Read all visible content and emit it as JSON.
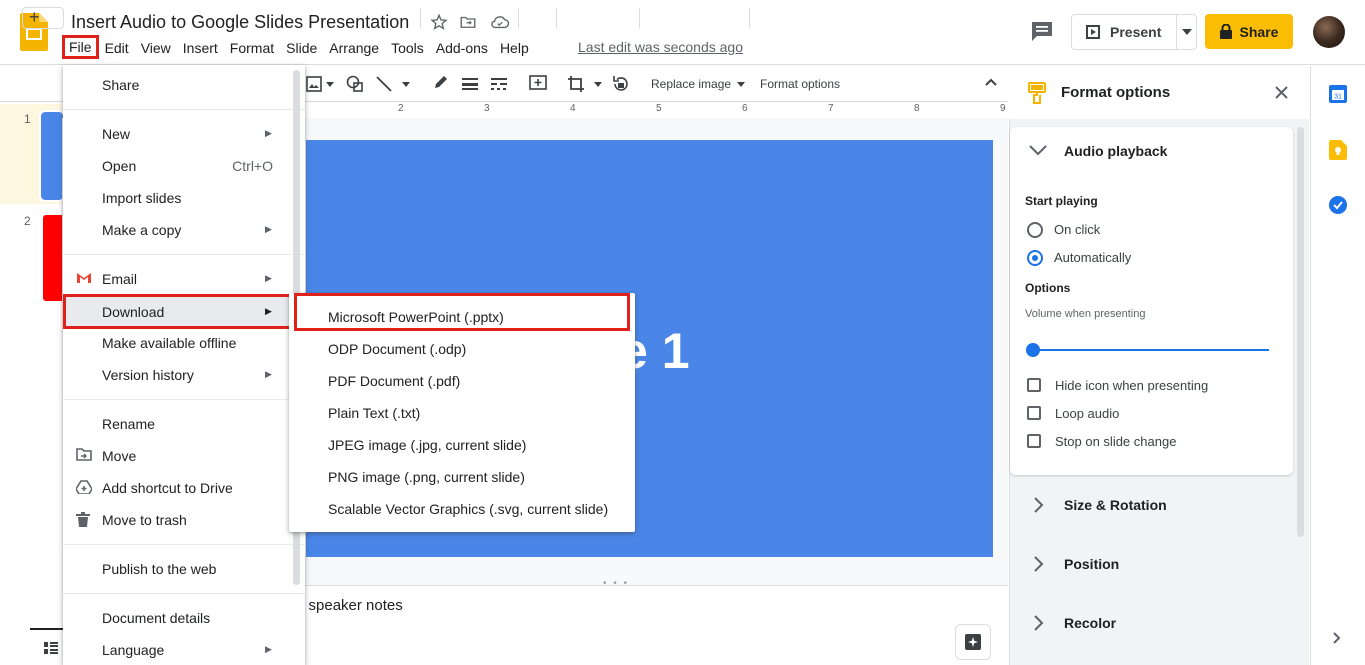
{
  "header": {
    "title": "Insert Audio to Google Slides Presentation",
    "last_edit": "Last edit was seconds ago",
    "present_label": "Present",
    "share_label": "Share",
    "menu": [
      "File",
      "Edit",
      "View",
      "Insert",
      "Format",
      "Slide",
      "Arrange",
      "Tools",
      "Add-ons",
      "Help"
    ]
  },
  "toolbar": {
    "add_label": "+",
    "replace_image": "Replace image",
    "format_options": "Format options"
  },
  "ruler": {
    "ticks": [
      "2",
      "3",
      "4",
      "5",
      "6",
      "7",
      "8",
      "9"
    ]
  },
  "filmstrip": {
    "slides": [
      "1",
      "2"
    ]
  },
  "slide": {
    "title_visible": "e 1",
    "speaker_notes_visible": "d speaker notes"
  },
  "file_menu": {
    "share": "Share",
    "new": "New",
    "open": "Open",
    "open_shortcut": "Ctrl+O",
    "import_slides": "Import slides",
    "make_copy": "Make a copy",
    "email": "Email",
    "download": "Download",
    "make_offline": "Make available offline",
    "version_history": "Version history",
    "rename": "Rename",
    "move": "Move",
    "add_shortcut": "Add shortcut to Drive",
    "move_trash": "Move to trash",
    "publish_web": "Publish to the web",
    "document_details": "Document details",
    "language": "Language"
  },
  "download_submenu": {
    "pptx": "Microsoft PowerPoint (.pptx)",
    "odp": "ODP Document (.odp)",
    "pdf": "PDF Document (.pdf)",
    "txt": "Plain Text (.txt)",
    "jpg": "JPEG image (.jpg, current slide)",
    "png": "PNG image (.png, current slide)",
    "svg": "Scalable Vector Graphics (.svg, current slide)"
  },
  "format_panel": {
    "title": "Format options",
    "audio_playback": "Audio playback",
    "start_playing": "Start playing",
    "on_click": "On click",
    "automatically": "Automatically",
    "selected_start": "Automatically",
    "options": "Options",
    "volume_label": "Volume when presenting",
    "volume_level": 0,
    "hide_icon": "Hide icon when presenting",
    "loop_audio": "Loop audio",
    "stop_on_change": "Stop on slide change",
    "size_rotation": "Size & Rotation",
    "position": "Position",
    "recolor": "Recolor"
  },
  "colors": {
    "accent_blue": "#1a73e8",
    "share_yellow": "#fbbc04",
    "slide_blue": "#4a86e8",
    "highlight_red": "#e0201b"
  }
}
